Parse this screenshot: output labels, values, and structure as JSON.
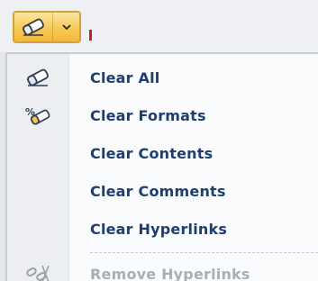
{
  "toolbar": {
    "clear_button_icon": "eraser-icon",
    "dropdown_icon": "dropdown-arrow-icon"
  },
  "menu": {
    "items": [
      {
        "label": "Clear All",
        "icon": "eraser-icon",
        "enabled": true
      },
      {
        "label": "Clear Formats",
        "icon": "clear-formats-icon",
        "enabled": true
      },
      {
        "label": "Clear Contents",
        "icon": "",
        "enabled": true
      },
      {
        "label": "Clear Comments",
        "icon": "",
        "enabled": true
      },
      {
        "label": "Clear Hyperlinks",
        "icon": "",
        "enabled": true
      },
      {
        "label": "Remove Hyperlinks",
        "icon": "remove-hyperlink-icon",
        "enabled": false
      }
    ]
  },
  "colors": {
    "accent": "#f7c956",
    "label_text": "#1d3e6e",
    "disabled_text": "#a7aeb8",
    "cell_marker": "#b8271f"
  }
}
